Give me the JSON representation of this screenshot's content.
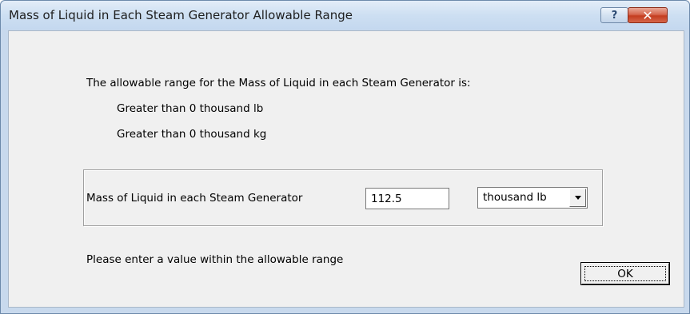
{
  "window": {
    "title": "Mass of Liquid in Each Steam Generator Allowable Range",
    "help_label": "?",
    "close_label": "✕"
  },
  "info": {
    "intro": "The allowable range for the Mass of Liquid in each Steam Generator is:",
    "range_lb": "Greater than 0 thousand lb",
    "range_kg": "Greater than 0 thousand kg"
  },
  "form": {
    "field_label": "Mass of Liquid in each Steam Generator",
    "value": "112.5",
    "unit_selected": "thousand lb"
  },
  "footer": {
    "message": "Please enter a value within the allowable range",
    "ok_label": "OK"
  }
}
